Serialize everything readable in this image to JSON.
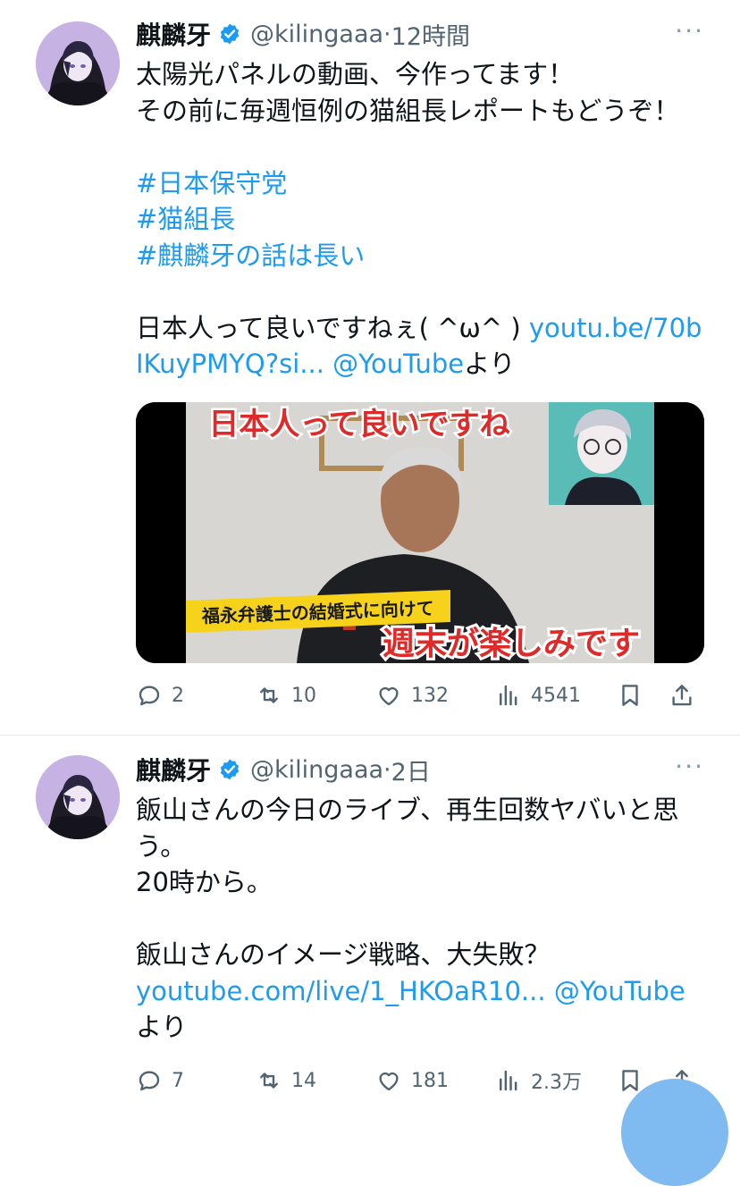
{
  "tweets": [
    {
      "name": "麒麟牙",
      "handle": "@kilingaaa",
      "separator": "·",
      "time": "12時間",
      "more": "···",
      "text_plain_1": "太陽光パネルの動画、今作ってます！\nその前に毎週恒例の猫組長レポートもどうぞ！\n\n",
      "hashtags": [
        "#日本保守党",
        "#猫組長",
        "#麒麟牙の話は長い"
      ],
      "text_plain_2": "\n\n日本人って良いですねぇ( ^ω^ ) ",
      "link": "youtu.be/70bIKuyPMYQ?si...",
      "mention": "@YouTube",
      "suffix": "より",
      "card": {
        "top_caption": "日本人って良いですね",
        "yellow_caption": "福永弁護士の結婚式に向けて",
        "bottom_caption": "週末が楽しみです"
      },
      "stats": {
        "replies": "2",
        "retweets": "10",
        "likes": "132",
        "views": "4541"
      }
    },
    {
      "name": "麒麟牙",
      "handle": "@kilingaaa",
      "separator": "·",
      "time": "2日",
      "more": "···",
      "text_plain_1": "飯山さんの今日のライブ、再生回数ヤバいと思う。\n20時から。\n\n飯山さんのイメージ戦略、大失敗？\n",
      "link": "youtube.com/live/1_HKOaR10...",
      "mention": "@YouTube",
      "suffix": "より",
      "stats": {
        "replies": "7",
        "retweets": "14",
        "likes": "181",
        "views": "2.3万"
      }
    }
  ],
  "icons": {
    "verified": "verified-badge-icon",
    "reply": "reply-bubble-icon",
    "retweet": "retweet-icon",
    "like": "heart-icon",
    "views": "bar-chart-icon",
    "bookmark": "bookmark-icon",
    "share": "share-upload-icon"
  },
  "colors": {
    "link": "#1d9bf0",
    "verified": "#1d9bf0",
    "secondary_text": "#536471",
    "compose_fab": "#7fbaf0"
  }
}
